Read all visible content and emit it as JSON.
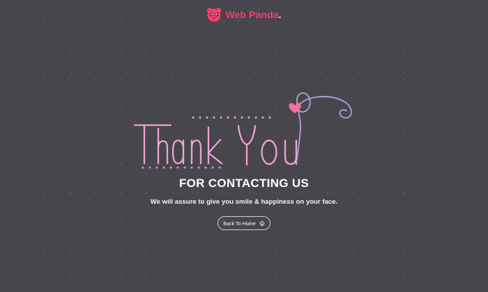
{
  "brand": {
    "name": "Web Panda",
    "dot": ".",
    "logo_icon": "panda-icon",
    "color": "#ff3c67"
  },
  "hero": {
    "text": "Thank You",
    "letter_color": "#f1a4cf",
    "flourish_color": "#b7a2dd",
    "heart_color": "#ff6f9e",
    "dot_top_color": "#f1a4cf",
    "dot_bottom_color": "#b7a2dd"
  },
  "main": {
    "headline": "FOR CONTACTING US",
    "message": "We will assure to give you smile & happiness on your face."
  },
  "button": {
    "label": "Back To Home",
    "icon": "home-icon"
  },
  "colors": {
    "background": "#47464d",
    "text": "#ffffff"
  }
}
